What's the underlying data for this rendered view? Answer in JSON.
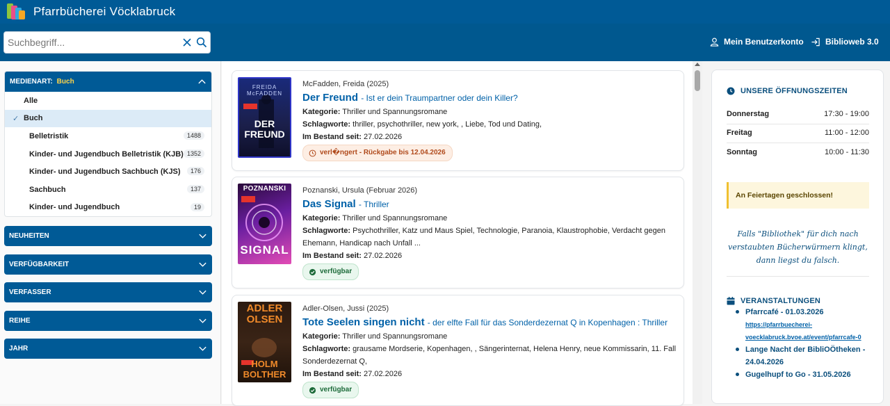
{
  "header": {
    "title": "Pfarrbücherei Vöcklabruck"
  },
  "search": {
    "placeholder": "Suchbegriff..."
  },
  "nav": {
    "account": "Mein Benutzerkonto",
    "biblioweb": "Biblioweb 3.0"
  },
  "filters": {
    "medienart": {
      "label": "MEDIENART:",
      "selected": "Buch",
      "items": [
        {
          "label": "Alle"
        },
        {
          "label": "Buch"
        }
      ],
      "subitems": [
        {
          "label": "Belletristik",
          "count": "1488"
        },
        {
          "label": "Kinder- und Jugendbuch Belletristik (KJB)",
          "count": "1352"
        },
        {
          "label": "Kinder- und Jugendbuch Sachbuch (KJS)",
          "count": "176"
        },
        {
          "label": "Sachbuch",
          "count": "137"
        },
        {
          "label": "Kinder- und Jugendbuch",
          "count": "19"
        }
      ]
    },
    "collapsed": [
      {
        "label": "NEUHEITEN"
      },
      {
        "label": "VERFÜGBARKEIT"
      },
      {
        "label": "VERFASSER"
      },
      {
        "label": "REIHE"
      },
      {
        "label": "JAHR"
      }
    ]
  },
  "books": [
    {
      "author": "McFadden, Freida (2025)",
      "title": "Der Freund",
      "subtitle": "- Ist er dein Traumpartner oder dein Killer?",
      "kategorie_label": "Kategorie:",
      "kategorie": "Thriller und Spannungsromane",
      "schlagworte_label": "Schlagworte:",
      "schlagworte": "thriller, psychothriller, new york, , Liebe, Tod und Dating,",
      "bestand_label": "Im Bestand seit:",
      "bestand": "27.02.2026",
      "status": "verl�ngert - Rückgabe bis 12.04.2026",
      "cover_text_top": "FREIDA\nMcFADDEN",
      "cover_text_main": "DER\nFREUND"
    },
    {
      "author": "Poznanski, Ursula (Februar 2026)",
      "title": "Das Signal",
      "subtitle": "- Thriller",
      "kategorie_label": "Kategorie:",
      "kategorie": "Thriller und Spannungsromane",
      "schlagworte_label": "Schlagworte:",
      "schlagworte": "Psychothriller, Katz und Maus Spiel, Technologie, Paranoia, Klaustrophobie, Verdacht gegen Ehemann, Handicap nach Unfall ...",
      "bestand_label": "Im Bestand seit:",
      "bestand": "27.02.2026",
      "status": "verfügbar",
      "cover_text_top": "POZNANSKI",
      "cover_text_main": "SIGNAL"
    },
    {
      "author": "Adler-Olsen, Jussi (2025)",
      "title": "Tote Seelen singen nicht",
      "subtitle": "- der elfte Fall für das Sonderdezernat Q in Kopenhagen : Thriller",
      "kategorie_label": "Kategorie:",
      "kategorie": "Thriller und Spannungsromane",
      "schlagworte_label": "Schlagworte:",
      "schlagworte": "grausame Mordserie, Kopenhagen, , Sängerinternat, Helena Henry, neue Kommissarin, 11. Fall Sonderdezernat Q,",
      "bestand_label": "Im Bestand seit:",
      "bestand": "27.02.2026",
      "status": "verfügbar",
      "cover_text_top": "ADLER\nOLSEN",
      "cover_text_main": "HOLM\nBOLTHER"
    }
  ],
  "opening": {
    "title": "UNSERE ÖFFNUNGSZEITEN",
    "rows": [
      {
        "day": "Donnerstag",
        "time": "17:30 - 19:00"
      },
      {
        "day": "Freitag",
        "time": "11:00 - 12:00"
      },
      {
        "day": "Sonntag",
        "time": "10:00 - 11:30"
      }
    ],
    "notice": "An Feiertagen geschlossen!",
    "quote": "Falls \"Bibliothek\" für dich nach verstaubten Bücherwürmern klingt, dann liegst du falsch."
  },
  "events": {
    "title": "VERANSTALTUNGEN",
    "items": [
      {
        "text": "Pfarrcafé - 01.03.2026",
        "link": "https://pfarrbuecherei-voecklabruck.bvoe.at/event/pfarrcafe-0"
      },
      {
        "text": "Lange Nacht der BibliOÖtheken - 24.04.2026",
        "link": ""
      },
      {
        "text": "Gugelhupf to Go - 31.05.2026",
        "link": ""
      }
    ]
  },
  "colors": {
    "brand": "#005a96",
    "link": "#0061a8",
    "loan": "#b04a1c",
    "available": "#1d6b3a"
  }
}
